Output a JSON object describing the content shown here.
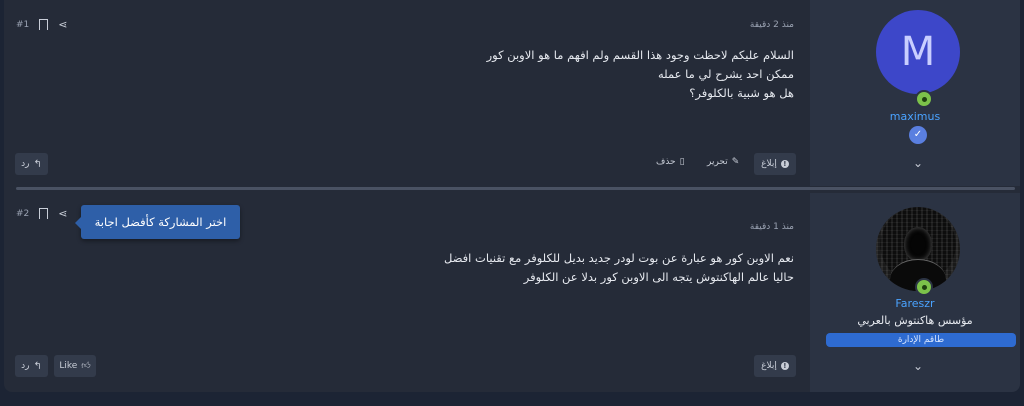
{
  "posts": [
    {
      "number": "#1",
      "time": "منذ 2 دقيقة",
      "lines": [
        "السلام عليكم لاحظت وجود هذا القسم ولم افهم ما هو الاوبن كور",
        "ممكن احد يشرح لي ما عمله",
        "هل هو شبية بالكلوفر؟"
      ],
      "author": {
        "avatar_letter": "M",
        "username": "maximus"
      },
      "actions": {
        "report": "إبلاغ",
        "edit": "تحرير",
        "delete": "حذف",
        "reply": "رد"
      }
    },
    {
      "number": "#2",
      "time": "منذ 1 دقيقة",
      "lines": [
        "نعم الاوبن كور هو عبارة عن بوت لودر جديد بديل للكلوفر مع تقنيات افضل",
        "حاليا عالم الهاكنتوش يتجه الى الاوبن كور بدلا عن الكلوفر"
      ],
      "author": {
        "username": "Fareszr",
        "user_title": "مؤسس هاكنتوش بالعربي",
        "role_banner": "طاقم الإدارة"
      },
      "actions": {
        "report": "إبلاغ",
        "like": "Like",
        "reply": "رد"
      }
    }
  ],
  "tooltip": "اختر المشاركة كأفضل اجابة",
  "icons": {
    "share": "share-icon",
    "bookmark": "bookmark-icon",
    "report": "report-icon",
    "edit": "pencil-icon",
    "delete": "trash-icon",
    "reply": "reply-icon",
    "like": "thumbs-up-icon",
    "expand": "chevron-down-icon"
  },
  "colors": {
    "page_bg": "#1c2434",
    "post_bg": "#252b38",
    "user_col_bg": "#2b3343",
    "username": "#4aa3ff",
    "avatar_m": "#3d47c9",
    "role_banner": "#2e6bd1",
    "tooltip": "#2e5fa8",
    "online": "#7cc24a"
  }
}
